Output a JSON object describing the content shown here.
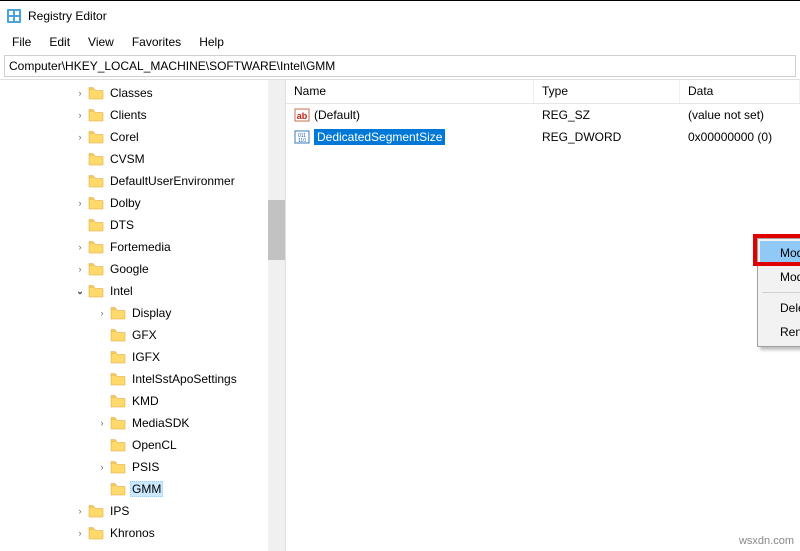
{
  "title": "Registry Editor",
  "menu": {
    "file": "File",
    "edit": "Edit",
    "view": "View",
    "favorites": "Favorites",
    "help": "Help"
  },
  "address": "Computer\\HKEY_LOCAL_MACHINE\\SOFTWARE\\Intel\\GMM",
  "tree": {
    "items": [
      {
        "indent": 74,
        "toggle": ">",
        "label": "Classes"
      },
      {
        "indent": 74,
        "toggle": ">",
        "label": "Clients"
      },
      {
        "indent": 74,
        "toggle": ">",
        "label": "Corel"
      },
      {
        "indent": 74,
        "toggle": "",
        "label": "CVSM"
      },
      {
        "indent": 74,
        "toggle": "",
        "label": "DefaultUserEnvironmer"
      },
      {
        "indent": 74,
        "toggle": ">",
        "label": "Dolby"
      },
      {
        "indent": 74,
        "toggle": "",
        "label": "DTS"
      },
      {
        "indent": 74,
        "toggle": ">",
        "label": "Fortemedia"
      },
      {
        "indent": 74,
        "toggle": ">",
        "label": "Google"
      },
      {
        "indent": 74,
        "toggle": "v",
        "label": "Intel"
      },
      {
        "indent": 96,
        "toggle": ">",
        "label": "Display"
      },
      {
        "indent": 96,
        "toggle": "",
        "label": "GFX"
      },
      {
        "indent": 96,
        "toggle": "",
        "label": "IGFX"
      },
      {
        "indent": 96,
        "toggle": "",
        "label": "IntelSstApoSettings"
      },
      {
        "indent": 96,
        "toggle": "",
        "label": "KMD"
      },
      {
        "indent": 96,
        "toggle": ">",
        "label": "MediaSDK"
      },
      {
        "indent": 96,
        "toggle": "",
        "label": "OpenCL"
      },
      {
        "indent": 96,
        "toggle": ">",
        "label": "PSIS"
      },
      {
        "indent": 96,
        "toggle": "",
        "label": "GMM",
        "selected": true
      },
      {
        "indent": 74,
        "toggle": ">",
        "label": "IPS"
      },
      {
        "indent": 74,
        "toggle": ">",
        "label": "Khronos"
      }
    ]
  },
  "list": {
    "columns": {
      "name": "Name",
      "type": "Type",
      "data": "Data"
    },
    "rows": [
      {
        "icon": "string",
        "name": "(Default)",
        "type": "REG_SZ",
        "data": "(value not set)",
        "selected": false
      },
      {
        "icon": "binary",
        "name": "DedicatedSegmentSize",
        "type": "REG_DWORD",
        "data": "0x00000000 (0)",
        "selected": true
      }
    ]
  },
  "contextMenu": {
    "modify": "Modify...",
    "modifyBinary": "Modify Binary Data...",
    "delete": "Delete",
    "rename": "Rename"
  },
  "watermark": "wsxdn.com"
}
